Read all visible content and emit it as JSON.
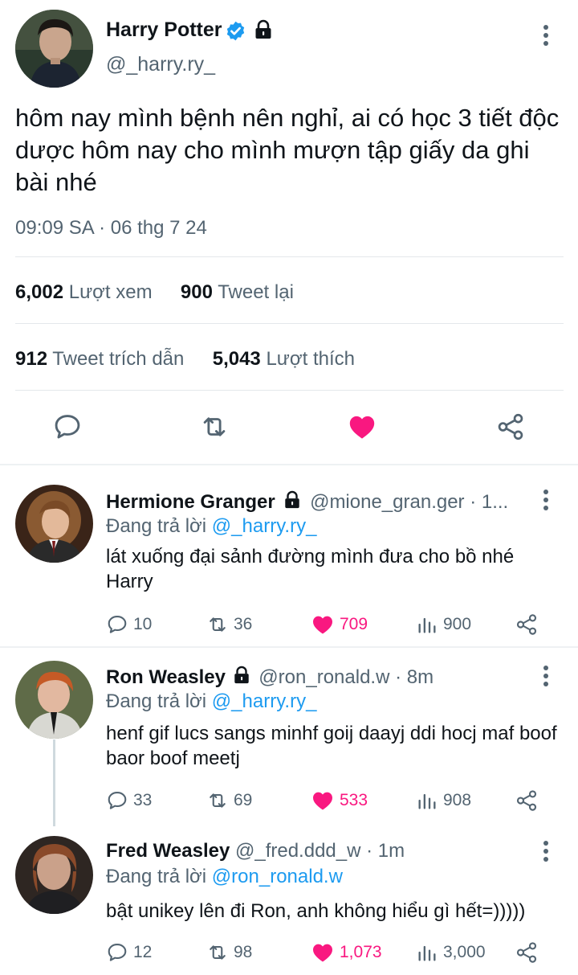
{
  "tweet": {
    "author": {
      "name": "Harry Potter",
      "handle": "@_harry.ry_",
      "verified": true,
      "protected": true
    },
    "text": "hôm nay mình bệnh nên nghỉ, ai có học 3 tiết độc dược hôm nay cho mình mượn tập giấy da ghi bài nhé",
    "timestamp": "09:09 SA · 06 thg 7 24",
    "stats": {
      "views_count": "6,002",
      "views_label": "Lượt xem",
      "retweets_count": "900",
      "retweets_label": "Tweet lại",
      "quotes_count": "912",
      "quotes_label": "Tweet trích dẫn",
      "likes_count": "5,043",
      "likes_label": "Lượt thích"
    },
    "icons": {
      "reply": "reply-icon",
      "retweet": "retweet-icon",
      "like": "heart-icon",
      "share": "share-icon"
    },
    "like_color": "#f91880"
  },
  "replies": [
    {
      "name": "Hermione Granger",
      "handle": "@mione_gran.ger · 1...",
      "protected": true,
      "replying_prefix": "Đang trả lời ",
      "replying_to": "@_harry.ry_",
      "text": "lát xuống đại sảnh đường mình đưa cho bồ nhé Harry",
      "replies": "10",
      "retweets": "36",
      "likes": "709",
      "views": "900"
    },
    {
      "name": "Ron Weasley",
      "handle": "@ron_ronald.w · 8m",
      "protected": true,
      "replying_prefix": "Đang trả lời ",
      "replying_to": "@_harry.ry_",
      "text": "henf gif lucs sangs minhf goij daayj ddi hocj maf boof baor boof meetj",
      "replies": "33",
      "retweets": "69",
      "likes": "533",
      "views": "908"
    },
    {
      "name": "Fred Weasley",
      "handle": "@_fred.ddd_w · 1m",
      "protected": false,
      "replying_prefix": "Đang trả lời ",
      "replying_to": "@ron_ronald.w",
      "text": "bật unikey lên đi Ron, anh không hiểu gì hết=)))))",
      "replies": "12",
      "retweets": "98",
      "likes": "1,073",
      "views": "3,000"
    }
  ],
  "colors": {
    "accent": "#1d9bf0",
    "muted": "#536471",
    "like": "#f91880",
    "text": "#0f1419"
  }
}
